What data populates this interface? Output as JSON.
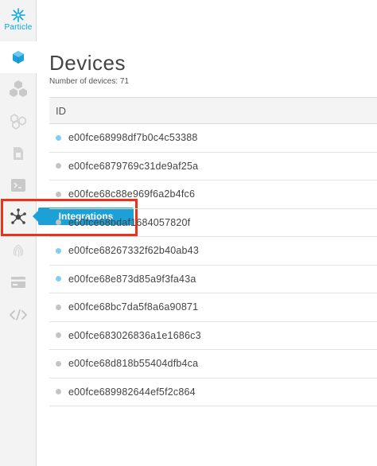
{
  "app": {
    "logo_text": "Particle"
  },
  "colors": {
    "accent": "#1ba0d8",
    "highlight": "#e8341c",
    "online": "#7fd0ef",
    "offline": "#c4c4c4"
  },
  "sidebar": {
    "items": [
      {
        "name": "devices",
        "icon": "cube-icon",
        "active": true
      },
      {
        "name": "products",
        "icon": "cubes-icon"
      },
      {
        "name": "mesh",
        "icon": "hexagons-icon"
      },
      {
        "name": "sim-cards",
        "icon": "sim-card-icon"
      },
      {
        "name": "console",
        "icon": "terminal-icon"
      },
      {
        "name": "integrations",
        "icon": "network-hub-icon"
      },
      {
        "name": "authentication",
        "icon": "fingerprint-icon"
      },
      {
        "name": "billing",
        "icon": "credit-card-icon"
      },
      {
        "name": "ide",
        "icon": "code-icon"
      }
    ],
    "tooltip": "Integrations"
  },
  "main": {
    "title": "Devices",
    "count_label": "Number of devices: 71",
    "table": {
      "header": "ID",
      "rows": [
        {
          "id": "e00fce68998df7b0c4c53388",
          "status": "online"
        },
        {
          "id": "e00fce6879769c31de9af25a",
          "status": "offline"
        },
        {
          "id": "e00fce68c88e969f6a2b4fc6",
          "status": "offline"
        },
        {
          "id": "e00fce68bdaf1684057820f",
          "status": "offline"
        },
        {
          "id": "e00fce68267332f62b40ab43",
          "status": "online"
        },
        {
          "id": "e00fce68e873d85a9f3fa43a",
          "status": "online"
        },
        {
          "id": "e00fce68bc7da5f8a6a90871",
          "status": "offline"
        },
        {
          "id": "e00fce683026836a1e1686c3",
          "status": "offline"
        },
        {
          "id": "e00fce68d818b55404dfb4ca",
          "status": "offline"
        },
        {
          "id": "e00fce689982644ef5f2c864",
          "status": "offline"
        }
      ]
    }
  }
}
